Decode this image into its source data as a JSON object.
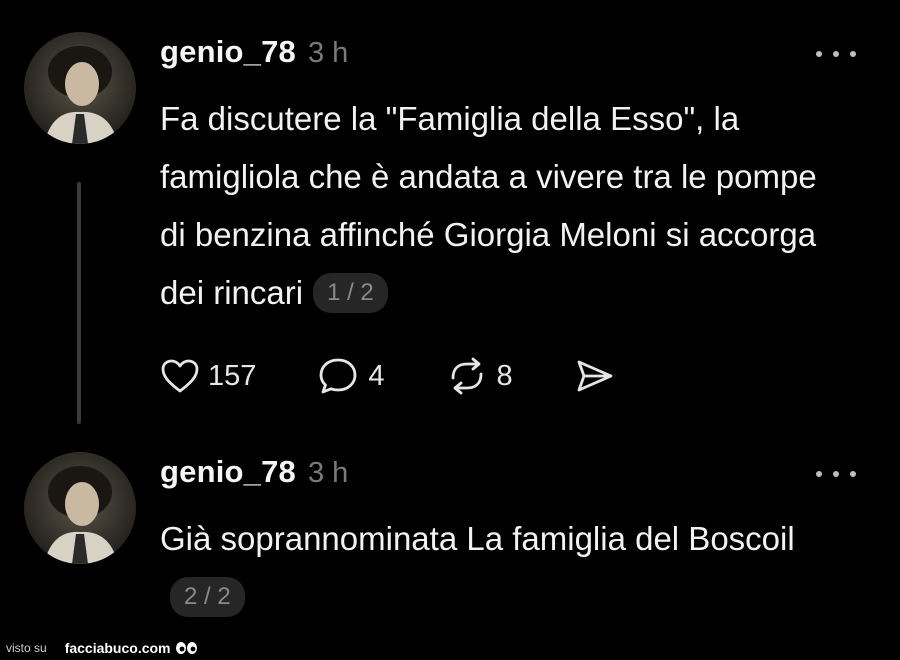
{
  "posts": [
    {
      "username": "genio_78",
      "time": "3 h",
      "text": "Fa discutere la \"Famiglia della Esso\", la famigliola che è andata a vivere tra le pompe di benzina affinché Giorgia Meloni si accorga dei rincari",
      "counter": "1 / 2",
      "likes": "157",
      "replies": "4",
      "reposts": "8"
    },
    {
      "username": "genio_78",
      "time": "3 h",
      "text": "Già soprannominata La famiglia del Boscoil",
      "counter": "2 / 2"
    }
  ],
  "footer": {
    "visto": "visto su",
    "brand": "facciabuco.com"
  },
  "icons": {
    "like": "heart-icon",
    "reply": "comment-icon",
    "repost": "repost-icon",
    "share": "send-icon",
    "more": "more-dots-icon"
  },
  "colors": {
    "background": "#000000",
    "text": "#f2f2f2",
    "muted": "#7a7a7a",
    "pill": "#262626"
  }
}
